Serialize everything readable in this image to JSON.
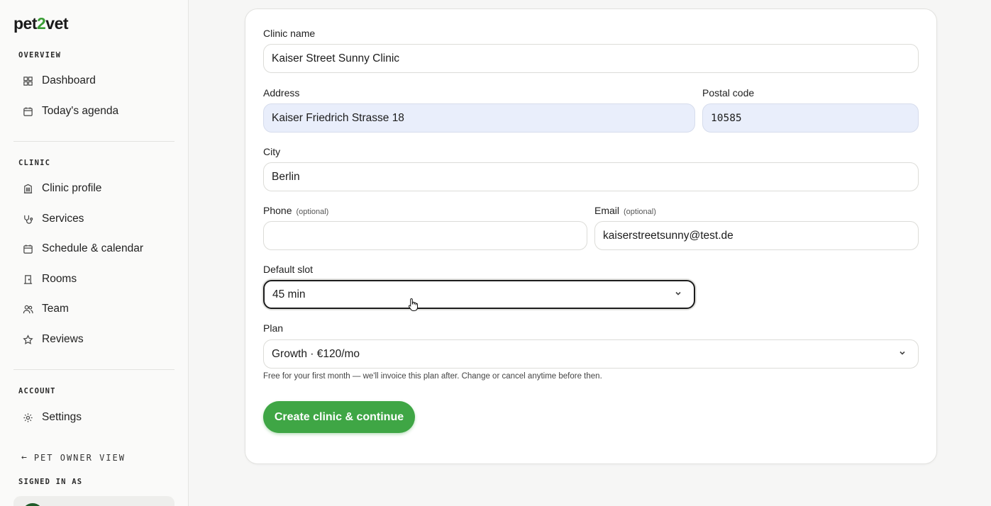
{
  "brand": {
    "logo_prefix": "pet",
    "logo_two": "2",
    "logo_suffix": "vet",
    "accent": "#3fa645"
  },
  "sidebar": {
    "overview_label": "OVERVIEW",
    "overview_items": [
      {
        "label": "Dashboard",
        "icon": "dashboard-icon"
      },
      {
        "label": "Today's agenda",
        "icon": "calendar-icon"
      }
    ],
    "clinic_label": "CLINIC",
    "clinic_items": [
      {
        "label": "Clinic profile",
        "icon": "building-icon"
      },
      {
        "label": "Services",
        "icon": "stethoscope-icon"
      },
      {
        "label": "Schedule & calendar",
        "icon": "calendar-icon"
      },
      {
        "label": "Rooms",
        "icon": "door-icon"
      },
      {
        "label": "Team",
        "icon": "users-icon"
      },
      {
        "label": "Reviews",
        "icon": "star-icon"
      }
    ],
    "account_label": "ACCOUNT",
    "account_items": [
      {
        "label": "Settings",
        "icon": "gear-icon"
      }
    ],
    "pet_owner_view": "PET OWNER VIEW",
    "signed_in_as": "SIGNED IN AS"
  },
  "form": {
    "clinic_name": {
      "label": "Clinic name",
      "value": "Kaiser Street Sunny Clinic"
    },
    "address": {
      "label": "Address",
      "value": "Kaiser Friedrich Strasse 18"
    },
    "postal_code": {
      "label": "Postal code",
      "value": "10585"
    },
    "city": {
      "label": "City",
      "value": "Berlin"
    },
    "phone": {
      "label": "Phone",
      "optional": "(optional)",
      "value": ""
    },
    "email": {
      "label": "Email",
      "optional": "(optional)",
      "value": "kaiserstreetsunny@test.de"
    },
    "default_slot": {
      "label": "Default slot",
      "value": "45 min"
    },
    "plan": {
      "label": "Plan",
      "value": "Growth · €120/mo"
    },
    "plan_hint": "Free for your first month — we'll invoice this plan after. Change or cancel anytime before then.",
    "submit": "Create clinic & continue"
  }
}
